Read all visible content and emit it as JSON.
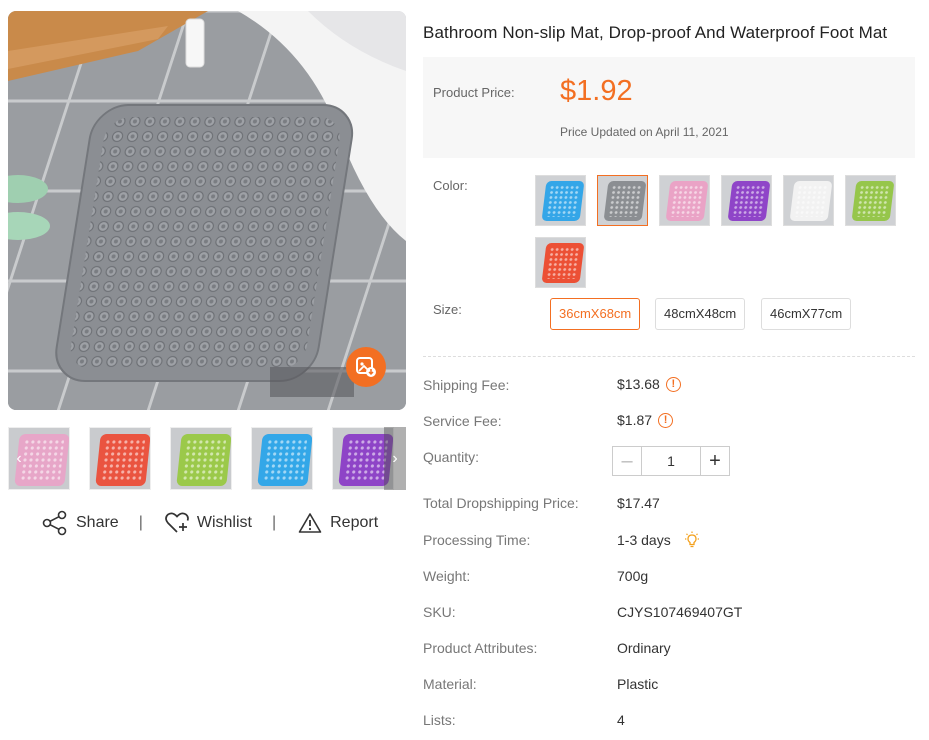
{
  "product": {
    "title": "Bathroom Non-slip Mat, Drop-proof And Waterproof Foot Mat",
    "price_label": "Product Price:",
    "price": "$1.92",
    "price_updated": "Price Updated on April 11, 2021"
  },
  "gallery": {
    "thumbnails": [
      {
        "color": "#e7a6c8"
      },
      {
        "color": "#ea5440"
      },
      {
        "color": "#9bc94a"
      },
      {
        "color": "#33a7e8"
      },
      {
        "color": "#8e44c7"
      },
      {
        "color": "#ffffff"
      }
    ],
    "next_icon": "chevron-right-icon",
    "prev_icon": "chevron-left-icon"
  },
  "actions": {
    "share": "Share",
    "wishlist": "Wishlist",
    "report": "Report",
    "separator": "|"
  },
  "options": {
    "color_label": "Color:",
    "colors": [
      {
        "color": "#34a6e8",
        "selected": false
      },
      {
        "color": "#8b8e92",
        "selected": true
      },
      {
        "color": "#eaa3c6",
        "selected": false
      },
      {
        "color": "#8f45c8",
        "selected": false
      },
      {
        "color": "#f2f2f2",
        "selected": false
      },
      {
        "color": "#96c64b",
        "selected": false
      },
      {
        "color": "#ec5035",
        "selected": false
      }
    ],
    "size_label": "Size:",
    "sizes": [
      {
        "label": "36cmX68cm",
        "selected": true
      },
      {
        "label": "48cmX48cm",
        "selected": false
      },
      {
        "label": "46cmX77cm",
        "selected": false
      }
    ]
  },
  "details": {
    "shipping_fee_label": "Shipping Fee:",
    "shipping_fee": "$13.68",
    "service_fee_label": "Service Fee:",
    "service_fee": "$1.87",
    "quantity_label": "Quantity:",
    "quantity": "1",
    "total_label": "Total Dropshipping Price:",
    "total": "$17.47",
    "processing_label": "Processing Time:",
    "processing": "1-3 days",
    "weight_label": "Weight:",
    "weight": "700g",
    "sku_label": "SKU:",
    "sku": "CJYS107469407GT",
    "attributes_label": "Product Attributes:",
    "attributes": "Ordinary",
    "material_label": "Material:",
    "material": "Plastic",
    "lists_label": "Lists:",
    "lists": "4"
  },
  "theme": {
    "accent": "#f36f22"
  }
}
